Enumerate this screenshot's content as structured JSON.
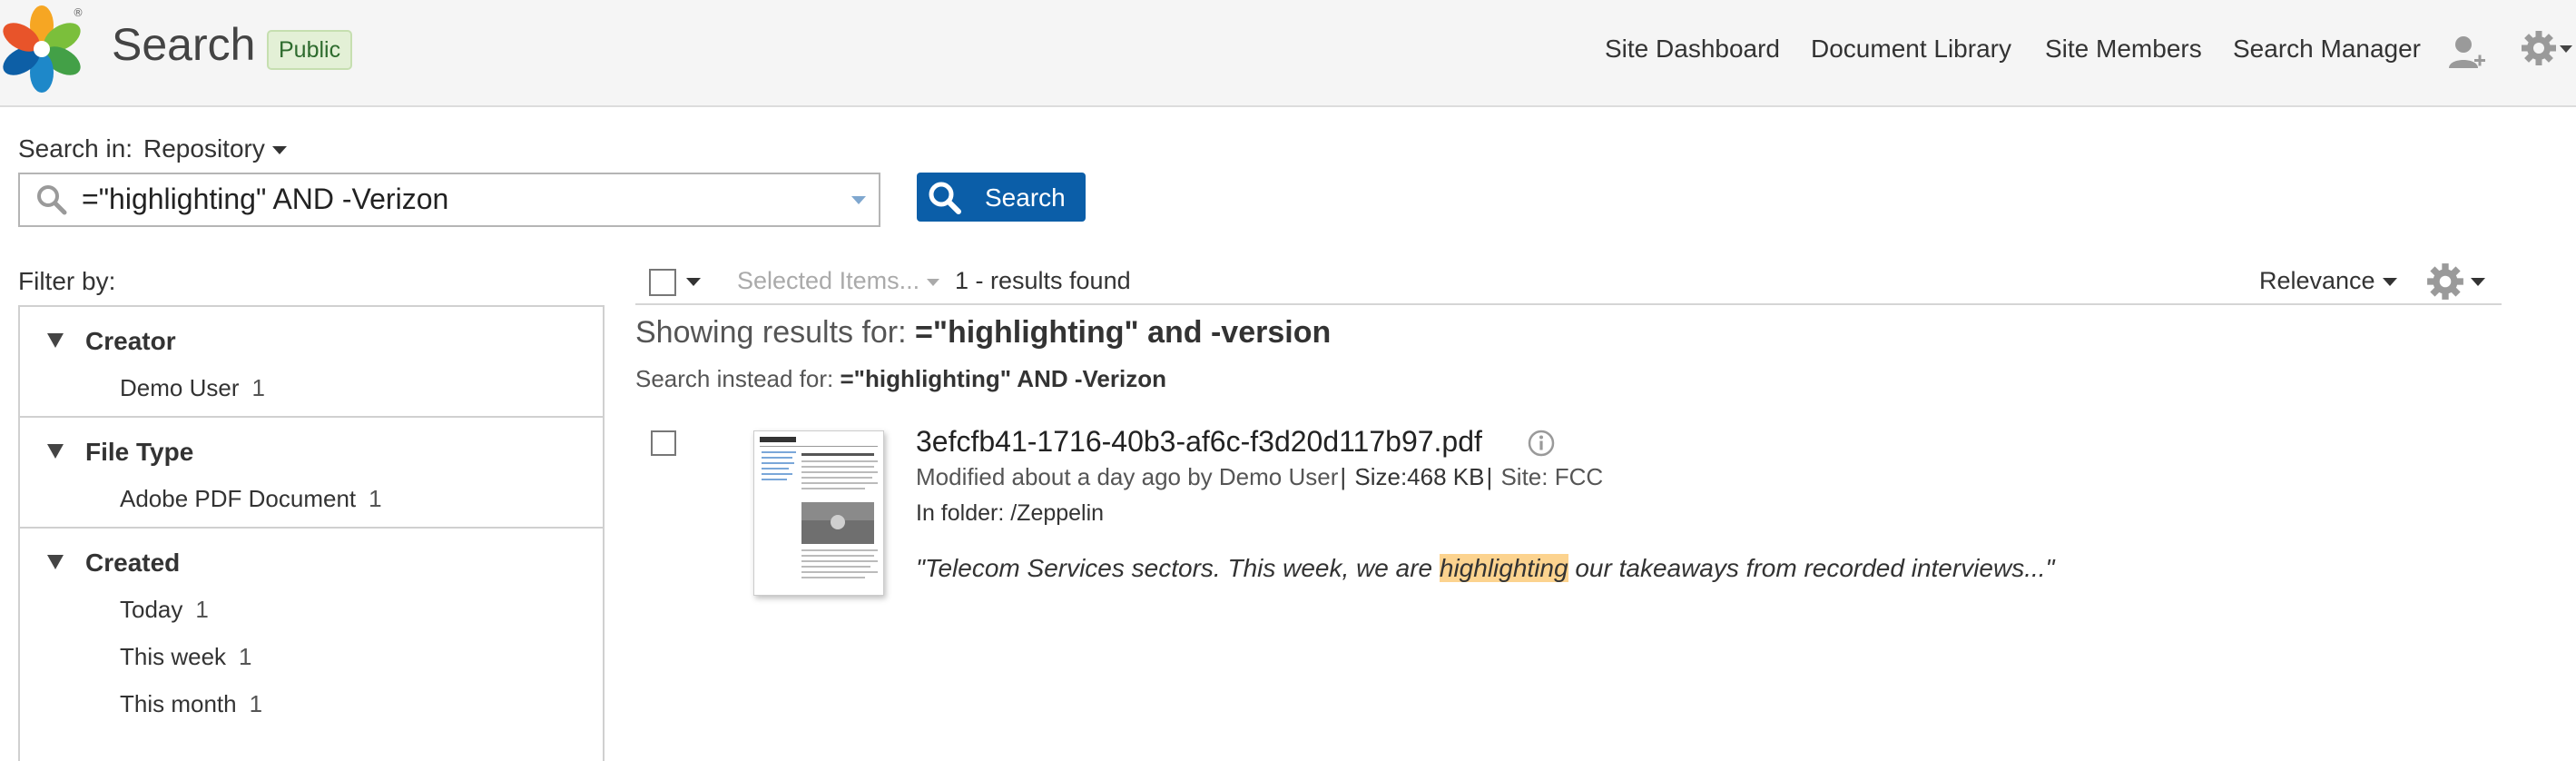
{
  "header": {
    "title": "Search",
    "badge": "Public",
    "nav": [
      "Site Dashboard",
      "Document Library",
      "Site Members",
      "Search Manager"
    ],
    "logo_mark": "®"
  },
  "search": {
    "search_in_label": "Search in:",
    "scope": "Repository",
    "query": "=\"highlighting\" AND -Verizon",
    "button_label": "Search"
  },
  "filters": {
    "label": "Filter by:",
    "groups": [
      {
        "title": "Creator",
        "items": [
          {
            "label": "Demo User",
            "count": "1"
          }
        ]
      },
      {
        "title": "File Type",
        "items": [
          {
            "label": "Adobe PDF Document",
            "count": "1"
          }
        ]
      },
      {
        "title": "Created",
        "items": [
          {
            "label": "Today",
            "count": "1"
          },
          {
            "label": "This week",
            "count": "1"
          },
          {
            "label": "This month",
            "count": "1"
          }
        ]
      }
    ]
  },
  "results": {
    "selected_items": "Selected Items...",
    "found": "1 - results found",
    "sort": "Relevance",
    "showing_prefix": "Showing results for:",
    "showing_query": "=\"highlighting\" and -version",
    "instead_prefix": "Search instead for:",
    "instead_query": "=\"highlighting\" AND -Verizon",
    "items": [
      {
        "name": "3efcfb41-1716-40b3-af6c-f3d20d117b97.pdf",
        "modified": "Modified about a day ago by Demo User",
        "size": "Size:468 KB",
        "site": "Site: FCC",
        "folder": "In folder: /Zeppelin",
        "snippet_before": "\"Telecom Services sectors. This week, we are ",
        "snippet_highlight": "highlighting",
        "snippet_after": " our takeaways from recorded interviews...\""
      }
    ]
  },
  "colors": {
    "primary_button": "#0b5ea8",
    "highlight": "#fcd38f",
    "badge_bg": "#e3f0d6"
  }
}
